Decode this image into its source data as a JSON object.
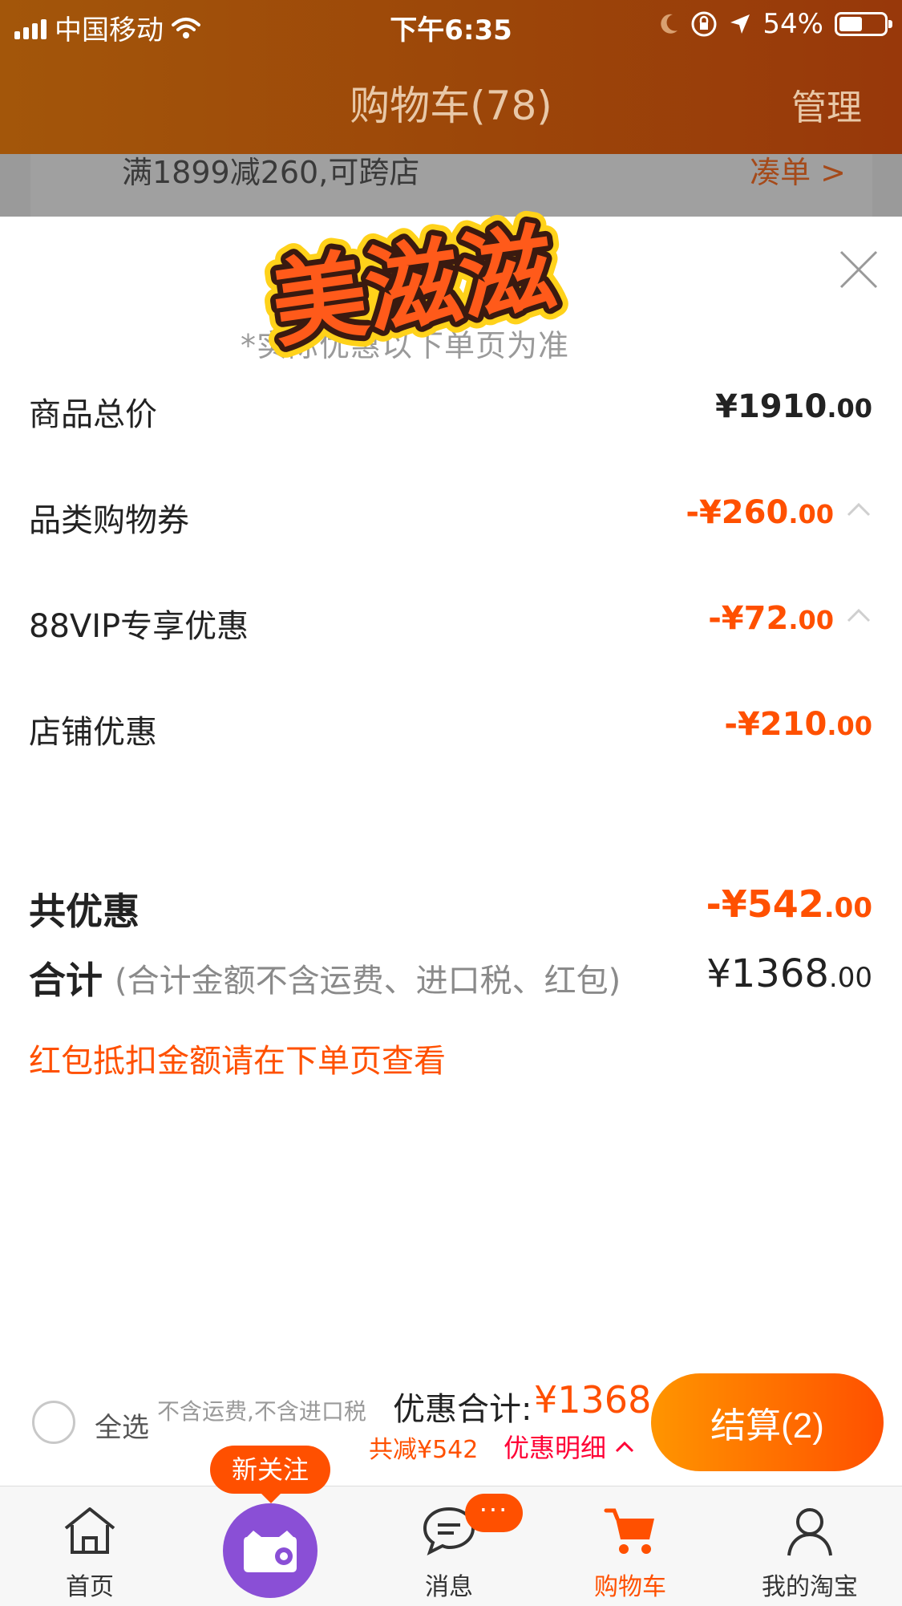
{
  "status_bar": {
    "carrier": "中国移动",
    "time": "下午6:35",
    "battery": "54%"
  },
  "nav": {
    "title": "购物车(78)",
    "manage": "管理"
  },
  "promo": {
    "text": "满1899减260,可跨店",
    "link": "凑单 >"
  },
  "sticker_text": "美滋滋",
  "note": "*实际优惠以下单页为准",
  "rows": [
    {
      "label": "商品总价",
      "value": "¥1910",
      "cents": ".00"
    },
    {
      "label": "品类购物券",
      "value": "-¥260",
      "cents": ".00"
    },
    {
      "label": "88VIP专享优惠",
      "value": "-¥72",
      "cents": ".00"
    },
    {
      "label": "店铺优惠",
      "value": "-¥210",
      "cents": ".00"
    }
  ],
  "total_discount": {
    "label": "共优惠",
    "value": "-¥542",
    "cents": ".00"
  },
  "sum": {
    "label": "合计",
    "note": "(合计金额不含运费、进口税、红包)",
    "value": "¥1368",
    "cents": ".00"
  },
  "redpack_note": "红包抵扣金额请在下单页查看",
  "checkout": {
    "select_all": "全选",
    "exclusions": "不含运费,不含进口税",
    "discount_label": "优惠合计:",
    "discount_value": "¥1368",
    "minus": "共减¥542",
    "detail": "优惠明细",
    "pay_button": "结算(2)"
  },
  "tabbar": {
    "new_follow": "新关注",
    "msg_badge": "···",
    "tabs": [
      {
        "label": "首页",
        "icon": "home-icon"
      },
      {
        "label": "",
        "icon": "camera-icon"
      },
      {
        "label": "消息",
        "icon": "message-icon"
      },
      {
        "label": "购物车",
        "icon": "cart-icon"
      },
      {
        "label": "我的淘宝",
        "icon": "user-icon"
      }
    ]
  },
  "colors": {
    "accent": "#ff5000",
    "header": "#9c4609",
    "purple": "#8a4fd6"
  }
}
